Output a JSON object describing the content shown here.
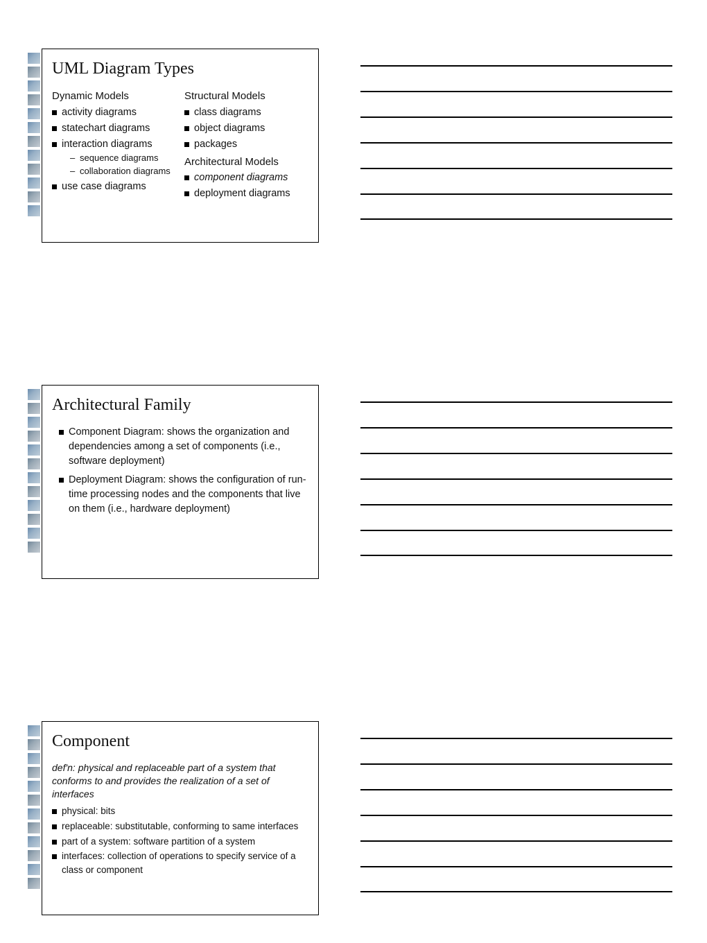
{
  "slides": [
    {
      "title": "UML Diagram Types",
      "left": {
        "heading": "Dynamic Models",
        "items": [
          {
            "text": "activity diagrams"
          },
          {
            "text": "statechart diagrams"
          },
          {
            "text": "interaction diagrams",
            "sub": [
              "sequence diagrams",
              "collaboration diagrams"
            ]
          },
          {
            "text": "use case diagrams"
          }
        ]
      },
      "right": {
        "heading1": "Structural Models",
        "items1": [
          {
            "text": "class diagrams"
          },
          {
            "text": "object diagrams"
          },
          {
            "text": "packages"
          }
        ],
        "heading2": "Architectural Models",
        "items2": [
          {
            "text": "component diagrams",
            "italic": true
          },
          {
            "text": "deployment diagrams"
          }
        ]
      }
    },
    {
      "title": "Architectural Family",
      "bullets": [
        "Component Diagram:  shows the organization and dependencies among a set of components (i.e., software deployment)",
        "Deployment Diagram:  shows the configuration of run-time processing nodes and the components that live on them (i.e., hardware deployment)"
      ]
    },
    {
      "title": "Component",
      "defn_lead": "def'n:  ",
      "defn_body": "physical and replaceable part of a system that conforms to and provides the realization of a set of interfaces",
      "bullets": [
        "physical:  bits",
        "replaceable:  substitutable, conforming to same interfaces",
        "part of a system:  software partition of a system",
        "interfaces:  collection of operations to specify service of a class or component"
      ]
    }
  ],
  "notes_line_count": 7
}
